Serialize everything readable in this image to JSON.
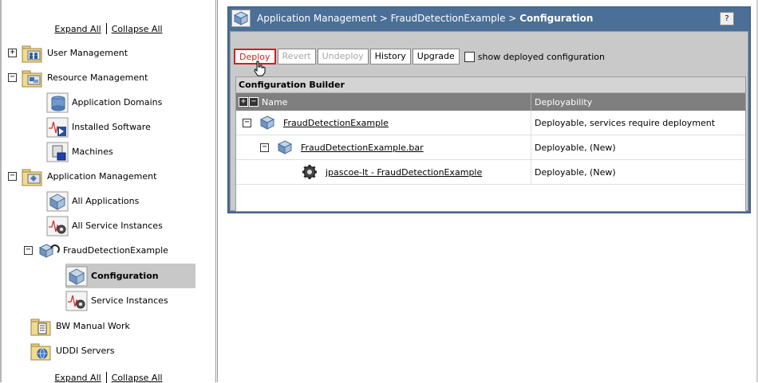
{
  "nav": {
    "expand_all": "Expand All",
    "collapse_all": "Collapse All",
    "items": [
      {
        "label": "User Management",
        "toggle": "+"
      },
      {
        "label": "Resource Management",
        "toggle": "−"
      },
      {
        "label": "Application Domains"
      },
      {
        "label": "Installed Software"
      },
      {
        "label": "Machines"
      },
      {
        "label": "Application Management",
        "toggle": "−"
      },
      {
        "label": "All Applications"
      },
      {
        "label": "All Service Instances"
      },
      {
        "label": "FraudDetectionExample",
        "toggle": "−"
      },
      {
        "label": "Configuration"
      },
      {
        "label": "Service Instances"
      },
      {
        "label": "BW Manual Work"
      },
      {
        "label": "UDDI Servers"
      }
    ]
  },
  "panel": {
    "breadcrumb_prefix": "Application Management > FraudDetectionExample > ",
    "breadcrumb_current": "Configuration",
    "help": "?",
    "toolbar": {
      "deploy": "Deploy",
      "revert": "Revert",
      "undeploy": "Undeploy",
      "history": "History",
      "upgrade": "Upgrade",
      "show_deployed": "show deployed configuration"
    },
    "builder": {
      "title": "Configuration Builder",
      "expand_all": "+",
      "collapse_all": "−",
      "col_name": "Name",
      "col_deployability": "Deployability",
      "rows": [
        {
          "toggle": "−",
          "name": "FraudDetectionExample",
          "deployability": "Deployable, services require deployment"
        },
        {
          "toggle": "−",
          "name": "FraudDetectionExample.bar",
          "deployability": "Deployable, (New)"
        },
        {
          "name": "jpascoe-lt - FraudDetectionExample",
          "deployability": "Deployable, (New)"
        }
      ]
    }
  }
}
